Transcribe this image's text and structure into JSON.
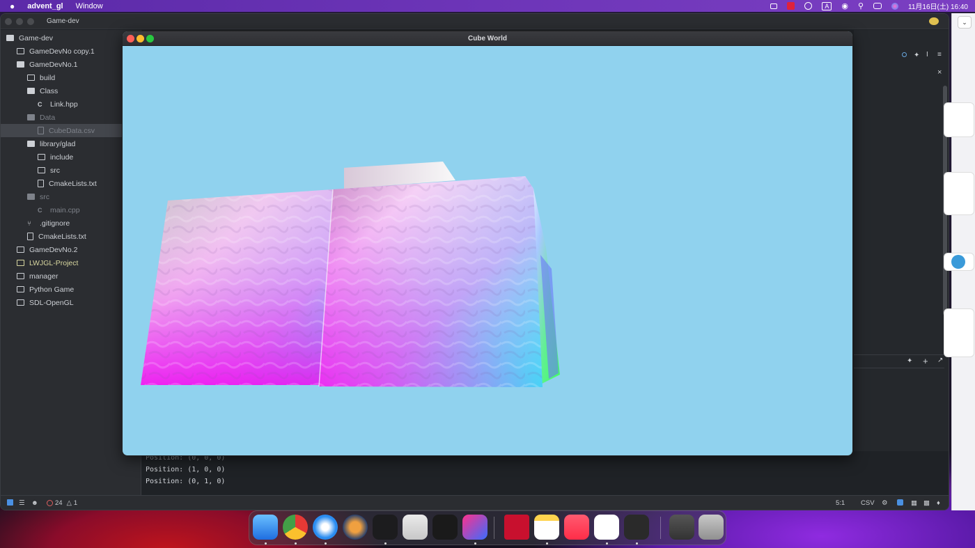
{
  "menubar": {
    "app_name": "advent_gl",
    "menu_window": "Window",
    "date_time": "11月16日(土) 16:40",
    "input_indicator": "A"
  },
  "ide": {
    "title": "Game-dev",
    "tree": [
      {
        "label": "Game-dev",
        "depth": 0,
        "type": "folder-open"
      },
      {
        "label": "GameDevNo copy.1",
        "depth": 1,
        "type": "folder"
      },
      {
        "label": "GameDevNo.1",
        "depth": 1,
        "type": "folder-open"
      },
      {
        "label": "build",
        "depth": 2,
        "type": "folder"
      },
      {
        "label": "Class",
        "depth": 2,
        "type": "folder-open"
      },
      {
        "label": "Link.hpp",
        "depth": 3,
        "type": "cfile"
      },
      {
        "label": "Data",
        "depth": 2,
        "type": "folder-open",
        "dim": true
      },
      {
        "label": "CubeData.csv",
        "depth": 3,
        "type": "table",
        "dim": true,
        "selected": true
      },
      {
        "label": "library/glad",
        "depth": 2,
        "type": "folder-open"
      },
      {
        "label": "include",
        "depth": 3,
        "type": "folder"
      },
      {
        "label": "src",
        "depth": 3,
        "type": "folder"
      },
      {
        "label": "CmakeLists.txt",
        "depth": 3,
        "type": "book"
      },
      {
        "label": "src",
        "depth": 2,
        "type": "folder-open",
        "dim": true
      },
      {
        "label": "main.cpp",
        "depth": 3,
        "type": "cfile",
        "dim": true
      },
      {
        "label": ".gitignore",
        "depth": 2,
        "type": "git"
      },
      {
        "label": "CmakeLists.txt",
        "depth": 2,
        "type": "book"
      },
      {
        "label": "GameDevNo.2",
        "depth": 1,
        "type": "folder"
      },
      {
        "label": "LWJGL-Project",
        "depth": 1,
        "type": "folder",
        "yellow": true
      },
      {
        "label": "manager",
        "depth": 1,
        "type": "folder"
      },
      {
        "label": "Python Game",
        "depth": 1,
        "type": "folder"
      },
      {
        "label": "SDL-OpenGL",
        "depth": 1,
        "type": "folder"
      }
    ],
    "console_lines": [
      "Position: (0, 0, 0)",
      "Position: (1, 0, 0)",
      "Position: (0, 1, 0)"
    ],
    "status": {
      "errors": "24",
      "warnings": "1",
      "cursor": "5:1",
      "file_type": "CSV"
    }
  },
  "cube_window": {
    "title": "Cube World",
    "background": "#90d2ee"
  },
  "dock": {
    "apps": [
      "finder-icon",
      "chrome-icon",
      "safari-icon",
      "blender-icon",
      "terminal-icon",
      "launchpad-icon",
      "zed-icon",
      "intellij-icon",
      "mcafee-icon",
      "notes-icon",
      "music-icon",
      "vscode-icon",
      "console-icon",
      "preview-icon",
      "trash-icon"
    ]
  }
}
